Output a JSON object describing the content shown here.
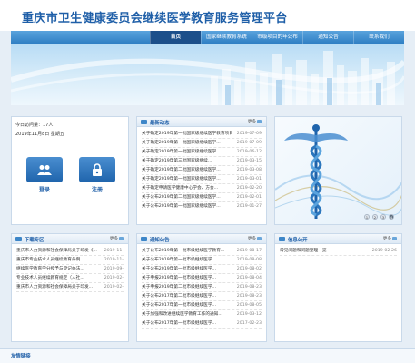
{
  "site_title": "重庆市卫生健康委员会继续医学教育服务管理平台",
  "nav": {
    "items": [
      {
        "label": "首页",
        "active": true
      },
      {
        "label": "国家继续教育系统",
        "active": false
      },
      {
        "label": "市级项目的年公布",
        "active": false
      },
      {
        "label": "通知公告",
        "active": false
      },
      {
        "label": "联系我们",
        "active": false
      }
    ]
  },
  "login": {
    "visits": "今日访问量：17人",
    "date": "2019年11月8日  星期五",
    "login_label": "登录",
    "register_label": "注册"
  },
  "news": {
    "title": "最新动态",
    "more": "更多",
    "items": [
      {
        "title": "关于确定2019年第一批国家级继续医学教育项目...",
        "date": "2019-07-09"
      },
      {
        "title": "关于确定2019年第一批国家级继续医学...",
        "date": "2019-07-09"
      },
      {
        "title": "关于确定2019年第一批国家级继续医学...",
        "date": "2019-06-12"
      },
      {
        "title": "关于确定2019年第三批国家级继续...",
        "date": "2019-03-15"
      },
      {
        "title": "关于确定2019年第二批国家级继续医学...",
        "date": "2019-03-08"
      },
      {
        "title": "关于确定2019年第一批国家级继续医学...",
        "date": "2019-03-01"
      },
      {
        "title": "关于确定申请医学健康中心学会、方会...",
        "date": "2019-02-20"
      },
      {
        "title": "关于公布2019年第二批国家级继续医学...",
        "date": "2019-02-01"
      },
      {
        "title": "关于公布2019年第一批国家级继续医学...",
        "date": "2019-01-27"
      }
    ]
  },
  "slider": {
    "pages": [
      "1",
      "2",
      "3",
      "4"
    ],
    "active_page": "4"
  },
  "downloads": {
    "title": "下载专区",
    "more": "更多",
    "items": [
      {
        "title": "重庆市人力资源和社会保障局关于印发《...",
        "date": "2019-11-"
      },
      {
        "title": "重庆市专业技术人员继续教育条例",
        "date": "2019-11-"
      },
      {
        "title": "继续医学教育学分授予与登记办法...",
        "date": "2019-09-"
      },
      {
        "title": "专业技术人员继续教育规定（人社...",
        "date": "2019-02-"
      },
      {
        "title": "重庆市人力资源和社会保障局关于印发...",
        "date": "2019-02-"
      }
    ]
  },
  "notices": {
    "title": "通知公告",
    "more": "更多",
    "items": [
      {
        "title": "关于公布2019年第一批市级继续医学教育...",
        "date": "2019-08-17"
      },
      {
        "title": "关于公布2019年第一批市级继续医学...",
        "date": "2019-08-08"
      },
      {
        "title": "关于公布2019年第一批市级继续医学...",
        "date": "2019-08-02"
      },
      {
        "title": "关于申报2019年第一批市级继续医学...",
        "date": "2019-08-04"
      },
      {
        "title": "关于申报2019年第二批市级继续医学...",
        "date": "2019-08-23"
      },
      {
        "title": "关于公布2017年第二批市级继续医学...",
        "date": "2019-08-23"
      },
      {
        "title": "关于公布2017年第一批市级继续医学...",
        "date": "2019-08-05"
      },
      {
        "title": "关于加强和改进继续医学教育工作的通知...",
        "date": "2019-03-12"
      },
      {
        "title": "关于公布2017年第一批市级继续医学...",
        "date": "2017-02-23"
      }
    ]
  },
  "credits": {
    "title": "信息公开",
    "more": "更多",
    "items": [
      {
        "title": "常见问题和问题整理一览",
        "date": "2019-02-26"
      }
    ]
  },
  "footer": {
    "title": "友情链接"
  },
  "colors": {
    "brand_blue": "#1f5fa8",
    "nav_blue": "#2f7fc4",
    "nav_active": "#1c4f8a"
  }
}
